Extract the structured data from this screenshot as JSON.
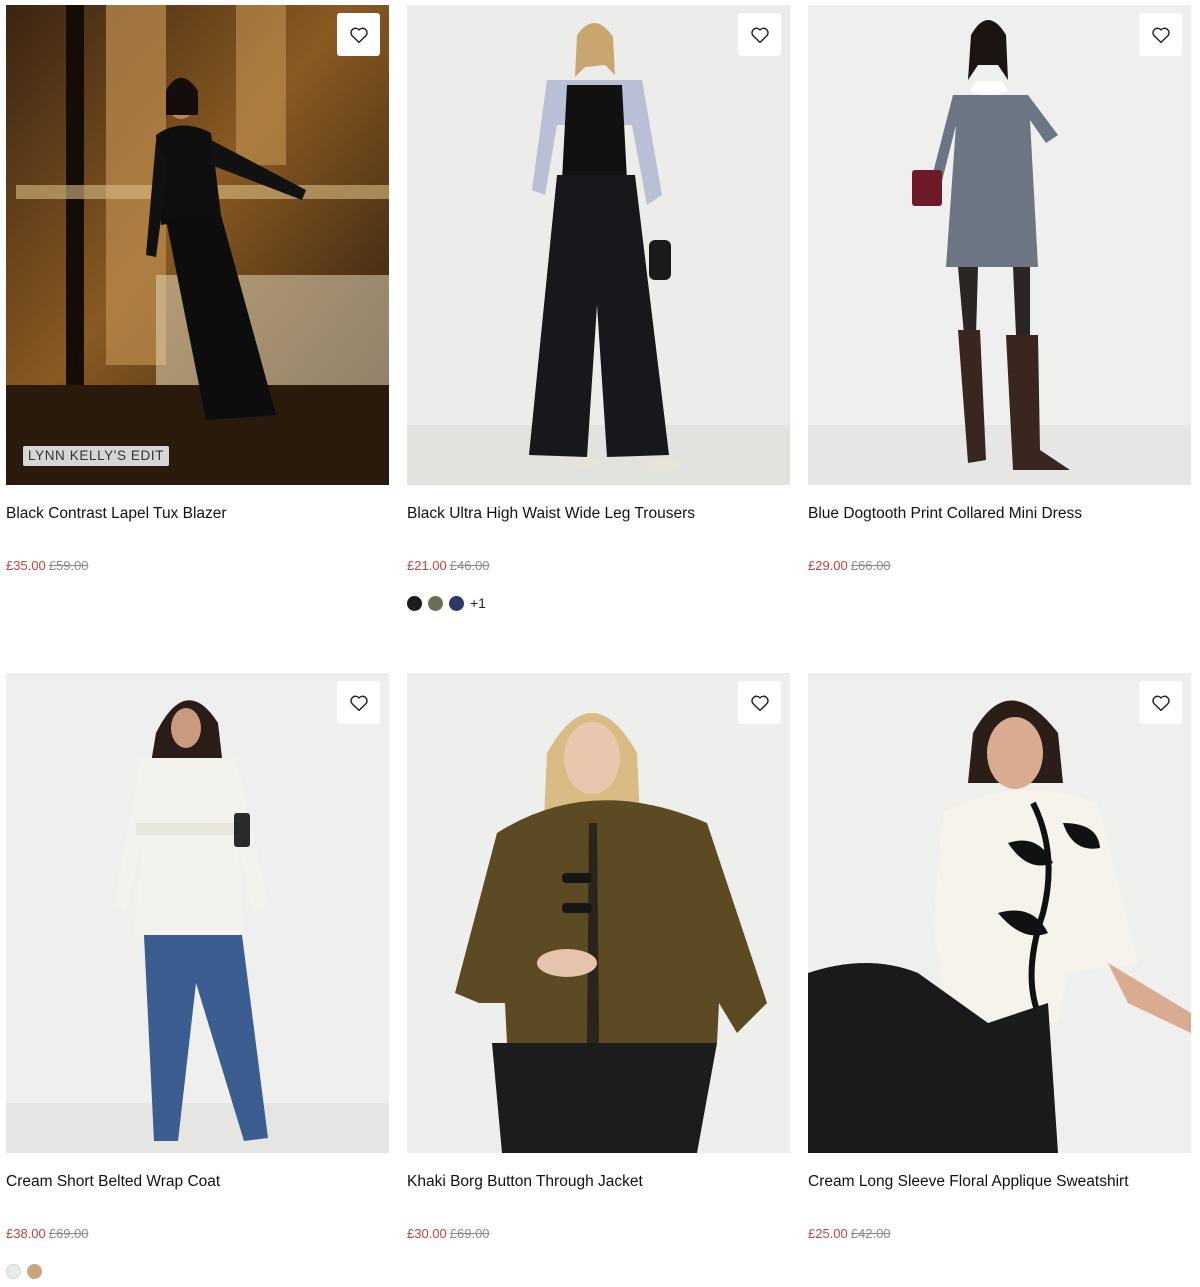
{
  "products": [
    {
      "name": "Black Contrast Lapel Tux Blazer",
      "sale_price": "£35.00",
      "was_price": "£59.00",
      "badge": "LYNN KELLY'S EDIT",
      "swatches": [],
      "more": ""
    },
    {
      "name": "Black Ultra High Waist Wide Leg Trousers",
      "sale_price": "£21.00",
      "was_price": "£46.00",
      "badge": "",
      "swatches": [
        "#1c1c1c",
        "#6b6f55",
        "#2c3a66"
      ],
      "more": "+1"
    },
    {
      "name": "Blue Dogtooth Print Collared Mini Dress",
      "sale_price": "£29.00",
      "was_price": "£66.00",
      "badge": "",
      "swatches": [],
      "more": ""
    },
    {
      "name": "Cream Short Belted Wrap Coat",
      "sale_price": "£38.00",
      "was_price": "£69.00",
      "badge": "",
      "swatches": [
        "#e8ece6",
        "#c9a57a"
      ],
      "more": ""
    },
    {
      "name": "Khaki Borg Button Through Jacket",
      "sale_price": "£30.00",
      "was_price": "£69.00",
      "badge": "",
      "swatches": [],
      "more": ""
    },
    {
      "name": "Cream Long Sleeve Floral Applique Sweatshirt",
      "sale_price": "£25.00",
      "was_price": "£42.00",
      "badge": "",
      "swatches": [],
      "more": ""
    }
  ],
  "colors": {
    "sale": "#c2433f",
    "was": "#8a8a8a"
  }
}
